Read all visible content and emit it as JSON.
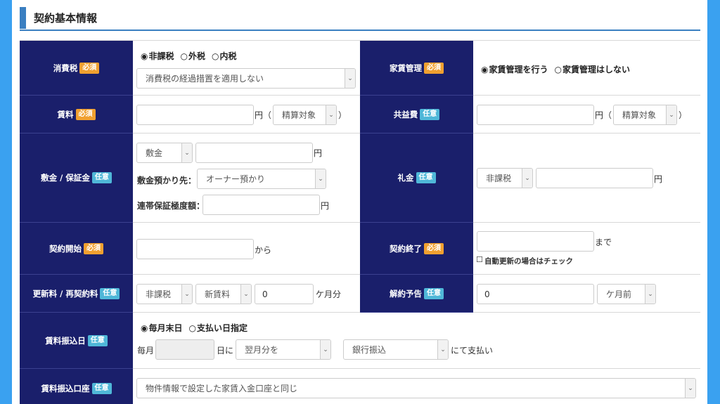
{
  "section": {
    "title": "契約基本情報"
  },
  "badges": {
    "required": "必須",
    "optional": "任意"
  },
  "labels": {
    "tax": "消費税",
    "rent_mgmt": "家賃管理",
    "rent": "賃料",
    "common_fee": "共益費",
    "deposit": "敷金 / 保証金",
    "key_money": "礼金",
    "start": "契約開始",
    "end": "契約終了",
    "renewal": "更新料 / 再契約料",
    "notice": "解約予告",
    "pay_day": "賃料振込日",
    "pay_account": "賃料振込口座"
  },
  "tax": {
    "options": [
      "非課税",
      "外税",
      "内税"
    ],
    "selected_index": 0,
    "transition_select": "消費税の経過措置を適用しない"
  },
  "rent_mgmt": {
    "options": [
      "家賃管理を行う",
      "家賃管理はしない"
    ],
    "selected_index": 0
  },
  "rent": {
    "value": "",
    "unit": "円（",
    "settle_select": "精算対象",
    "close": "）"
  },
  "common_fee": {
    "value": "",
    "unit": "円（",
    "settle_select": "精算対象",
    "close": "）"
  },
  "deposit": {
    "type_select": "敷金",
    "value": "",
    "unit": "円",
    "holder_label": "敷金預かり先：",
    "holder_select": "オーナー預かり",
    "guarantee_label": "連帯保証極度額：",
    "guarantee_value": "",
    "guarantee_unit": "円"
  },
  "key_money": {
    "tax_select": "非課税",
    "value": "",
    "unit": "円"
  },
  "start": {
    "value": "",
    "suffix": "から"
  },
  "end": {
    "value": "",
    "suffix": "まで",
    "auto_renew_checkbox": "☐",
    "auto_renew_label": "自動更新の場合はチェック"
  },
  "renewal": {
    "tax_select": "非課税",
    "basis_select": "新賃料",
    "months_value": "0",
    "months_unit": "ケ月分"
  },
  "notice": {
    "value": "0",
    "unit_select": "ケ月前"
  },
  "pay_day": {
    "options": [
      "毎月末日",
      "支払い日指定"
    ],
    "selected_index": 0,
    "prefix": "毎月",
    "day_value": "",
    "day_suffix": "日に",
    "month_select": "翌月分を",
    "method_select": "銀行振込",
    "suffix": "にて支払い"
  },
  "pay_account": {
    "select": "物件情報で設定した家賃入金口座と同じ"
  },
  "radio": {
    "on": "◉",
    "off": "○"
  }
}
